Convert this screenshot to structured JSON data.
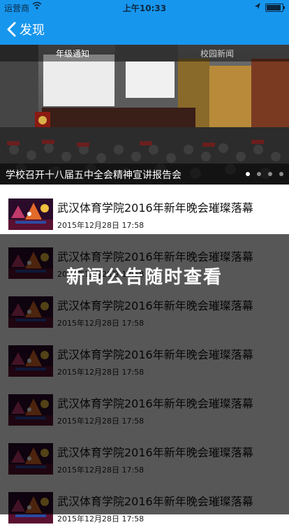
{
  "status_bar": {
    "carrier": "运营商",
    "time": "上午10:33",
    "icons": [
      "wifi-icon",
      "location-icon",
      "battery-icon"
    ]
  },
  "nav": {
    "back_label": "发现",
    "back_icon": "chevron-left-icon"
  },
  "banner": {
    "tabs": [
      "年级通知",
      "校园新闻"
    ],
    "active_tab": 0,
    "caption": "学校召开十八届五中全会精神宣讲报告会",
    "slide_count": 4,
    "active_slide": 0
  },
  "news_items": [
    {
      "title": "武汉体育学院2016年新年晚会璀璨落幕",
      "date": "2015年12月28日 17:58"
    },
    {
      "title": "武汉体育学院2016年新年晚会璀璨落幕",
      "date": "2015年12月28日 17:58"
    },
    {
      "title": "武汉体育学院2016年新年晚会璀璨落幕",
      "date": "2015年12月28日 17:58"
    },
    {
      "title": "武汉体育学院2016年新年晚会璀璨落幕",
      "date": "2015年12月28日 17:58"
    },
    {
      "title": "武汉体育学院2016年新年晚会璀璨落幕",
      "date": "2015年12月28日 17:58"
    },
    {
      "title": "武汉体育学院2016年新年晚会璀璨落幕",
      "date": "2015年12月28日 17:58"
    },
    {
      "title": "武汉体育学院2016年新年晚会璀璨落幕",
      "date": "2015年12月28日 17:58"
    }
  ],
  "overlay": {
    "text": "新闻公告随时查看"
  },
  "colors": {
    "brand_blue": "#1796ee",
    "overlay": "#000000"
  }
}
